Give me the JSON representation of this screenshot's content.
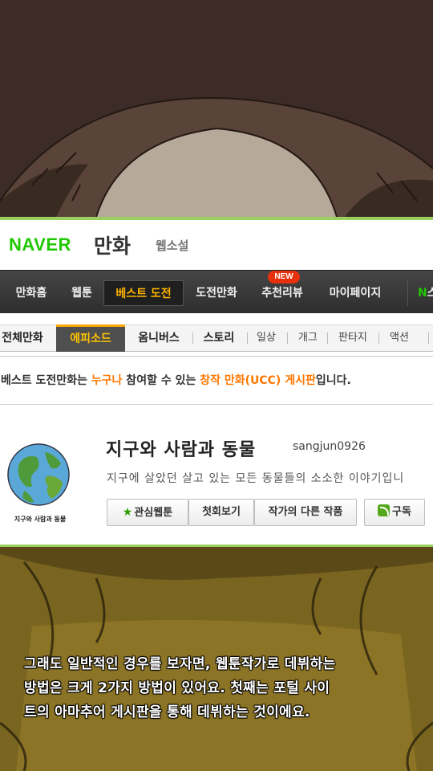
{
  "header": {
    "brand": "NAVER",
    "service": "만화",
    "sub_service": "웹소설"
  },
  "gnb": {
    "items": [
      {
        "label": "만화홈",
        "active": false
      },
      {
        "label": "웹툰",
        "active": false
      },
      {
        "label": "베스트 도전",
        "active": true
      },
      {
        "label": "도전만화",
        "active": false
      },
      {
        "label": "추천리뷰",
        "active": false
      },
      {
        "label": "마이페이지",
        "active": false
      }
    ],
    "new_badge": "NEW",
    "partial_item": "N",
    "partial_item_rest": "스"
  },
  "subnav": {
    "tabs": [
      {
        "label": "전체만화",
        "active": false
      },
      {
        "label": "에피소드",
        "active": true
      },
      {
        "label": "옴니버스",
        "active": false
      },
      {
        "label": "스토리",
        "active": false
      }
    ],
    "genres": [
      "일상",
      "개그",
      "판타지",
      "액션"
    ]
  },
  "notice": {
    "prefix": "베스트 도전만화는 ",
    "highlight1": "누구나",
    "middle": " 참여할 수 있는 ",
    "highlight2": "창작 만화(UCC) 게시판",
    "suffix": "입니다."
  },
  "comic": {
    "title": "지구와 사람과 동물",
    "author": "sangjun0926",
    "description": "지구에 살았던 살고 있는 모든 동물들의 소소한 이야기입니",
    "thumb_caption": "지구와 사람과 동물",
    "buttons": {
      "favorite": "관심웹툰",
      "first": "첫회보기",
      "other": "작가의 다른 작품",
      "subscribe": "구독"
    }
  },
  "caption": {
    "lines": [
      "그래도 일반적인 경우를 보자면, 웹툰작가로 데뷔하는",
      "방법은 크게 2가지 방법이 있어요. 첫째는 포털 사이",
      "트의 아마추어 게시판을 통해 데뷔하는 것이에요."
    ]
  },
  "colors": {
    "naver_green": "#1ec800",
    "active_orange": "#ffb400",
    "notice_orange": "#ff7800",
    "card_border": "#9ad05f"
  }
}
